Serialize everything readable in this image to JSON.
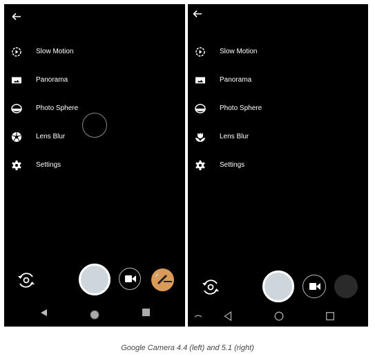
{
  "panels": [
    {
      "version": "Google Camera 4.4",
      "menu": [
        {
          "label": "Slow Motion",
          "icon": "slow-motion-icon"
        },
        {
          "label": "Panorama",
          "icon": "panorama-icon"
        },
        {
          "label": "Photo Sphere",
          "icon": "photo-sphere-icon"
        },
        {
          "label": "Lens Blur",
          "icon": "lens-blur-aperture-icon"
        },
        {
          "label": "Settings",
          "icon": "gear-icon"
        }
      ],
      "thumbnail_color": "#d99a5a",
      "nav": [
        "back-triangle-icon",
        "home-circle-icon",
        "recents-square-icon"
      ]
    },
    {
      "version": "Google Camera 5.1",
      "menu": [
        {
          "label": "Slow Motion",
          "icon": "slow-motion-icon"
        },
        {
          "label": "Panorama",
          "icon": "panorama-icon"
        },
        {
          "label": "Photo Sphere",
          "icon": "photo-sphere-icon"
        },
        {
          "label": "Lens Blur",
          "icon": "lens-blur-flower-icon"
        },
        {
          "label": "Settings",
          "icon": "gear-icon"
        }
      ],
      "thumbnail_color": "#2a2a2a",
      "nav": [
        "keyboard-hide-icon",
        "back-triangle-icon",
        "home-circle-icon",
        "recents-square-icon"
      ]
    }
  ],
  "caption": "Google Camera 4.4 (left) and 5.1 (right)"
}
